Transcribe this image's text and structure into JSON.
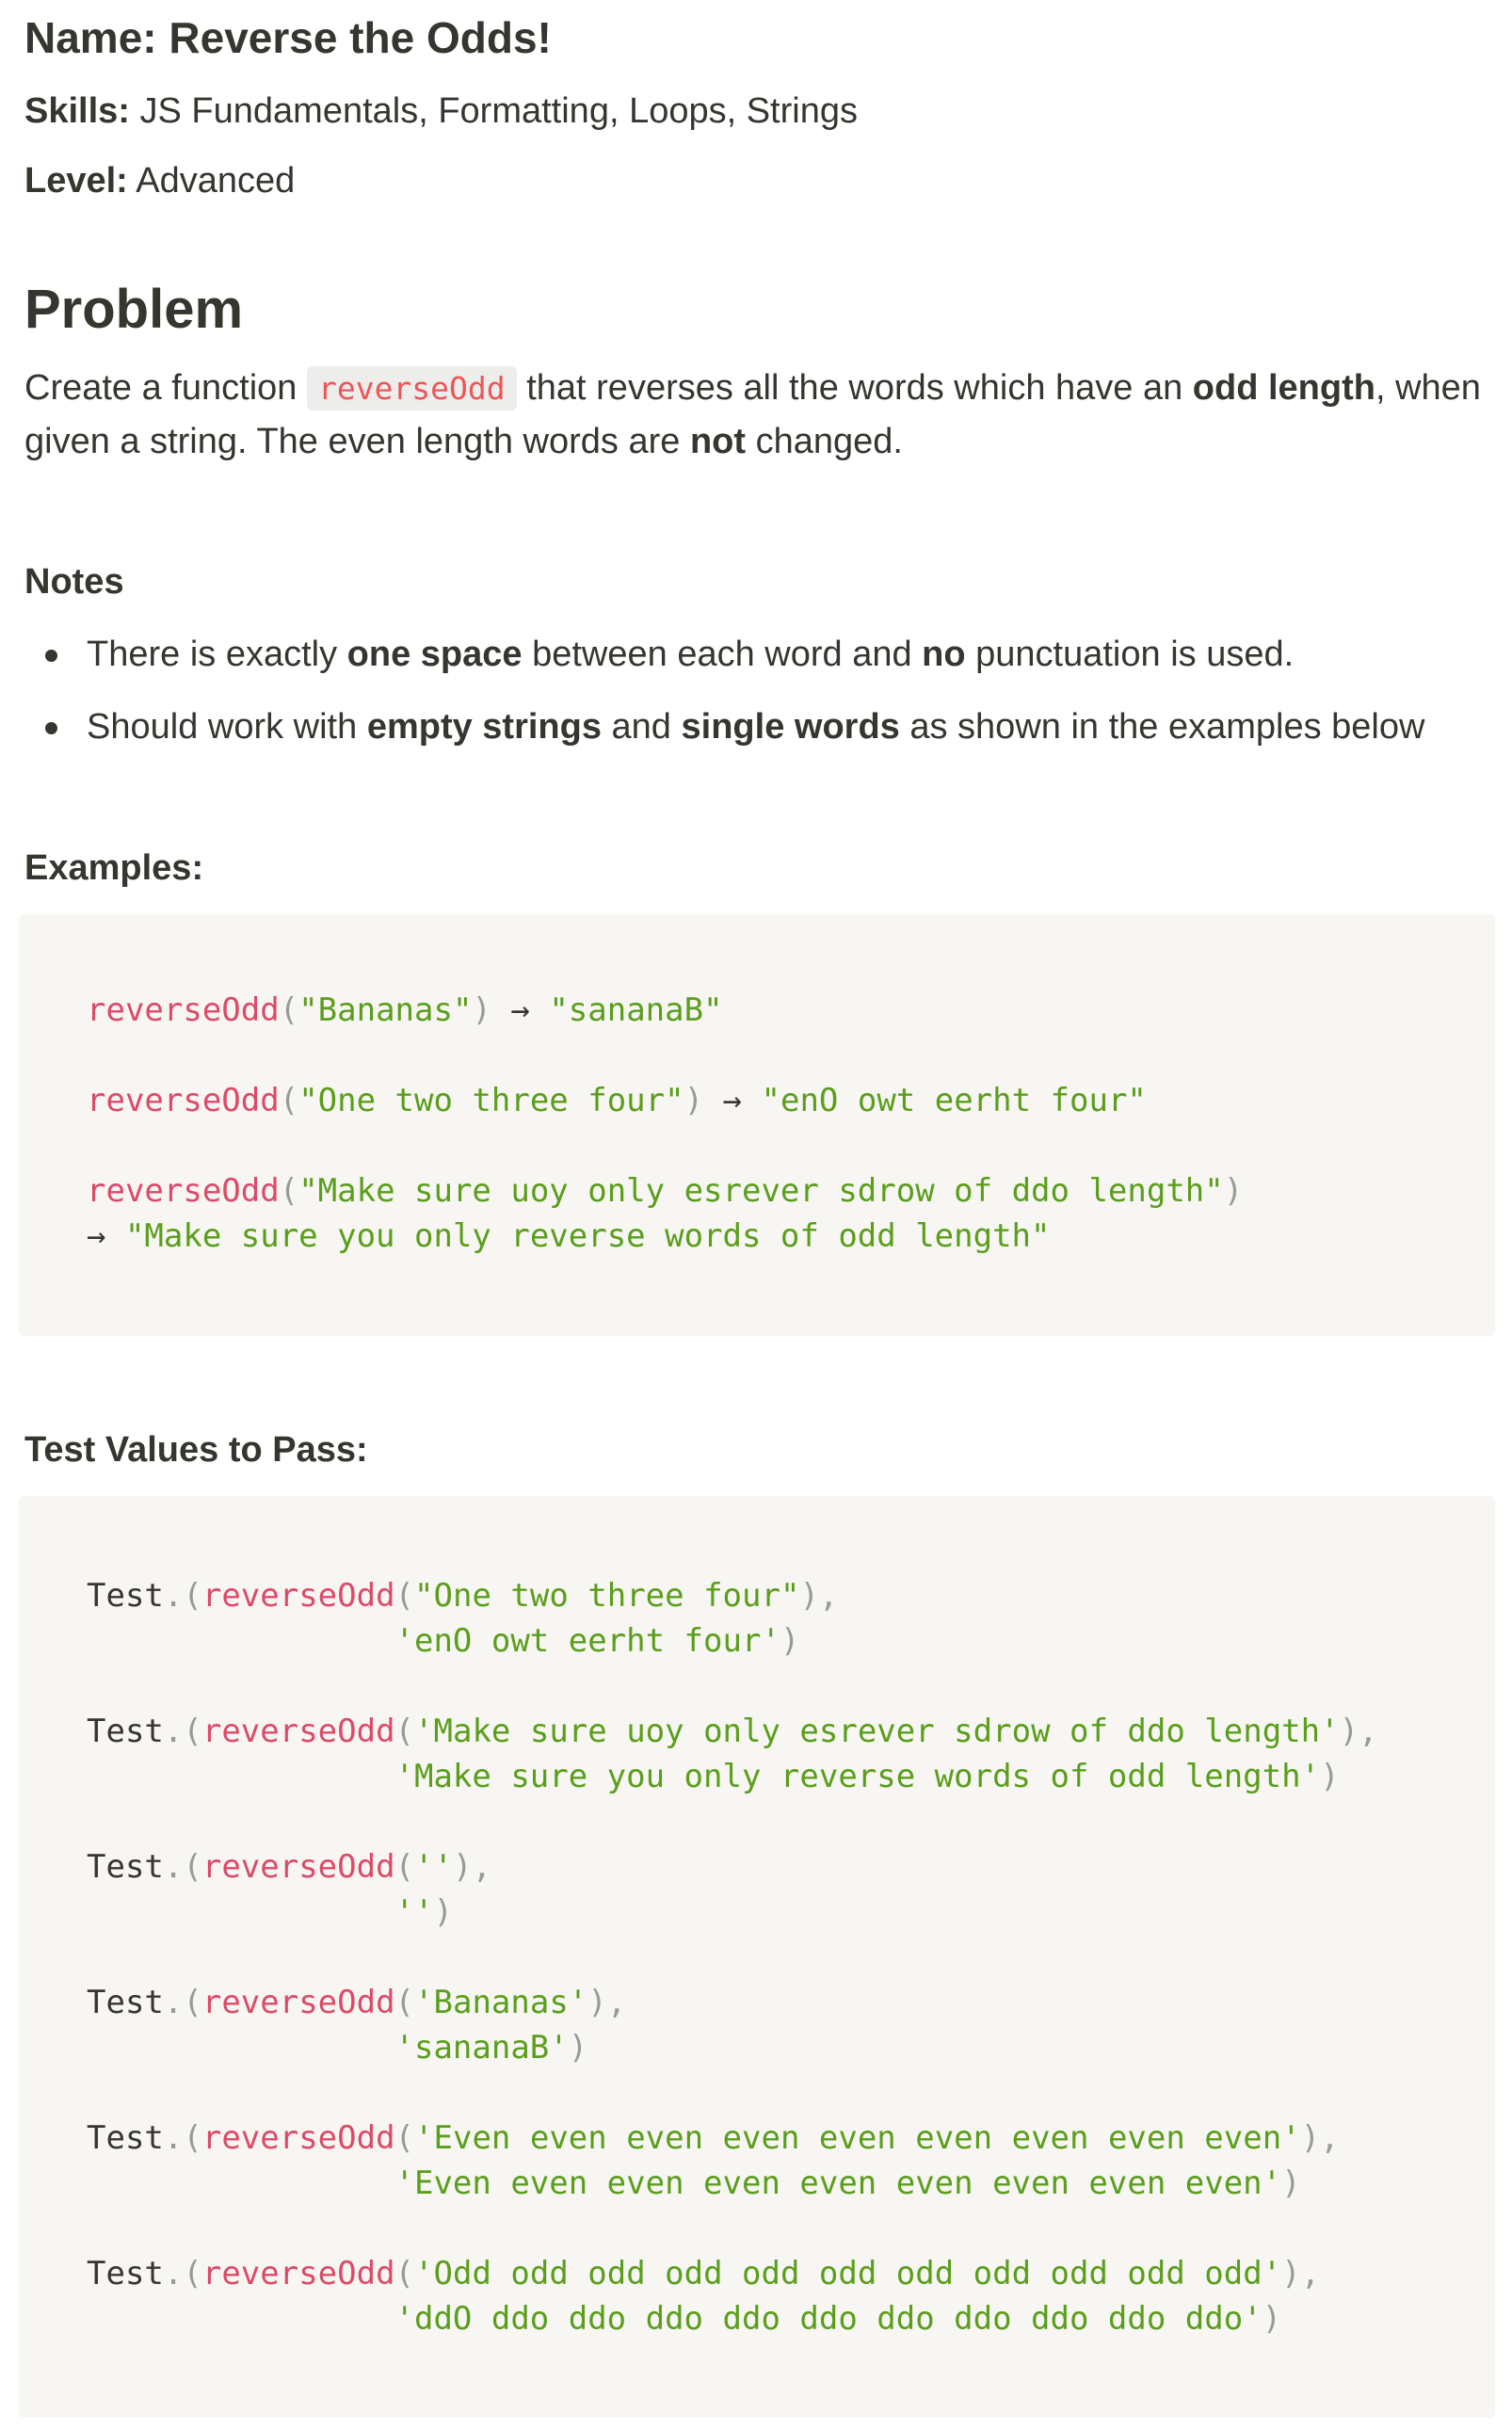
{
  "header": {
    "name_label": "Name:",
    "name_value": "Reverse the Odds!",
    "skills_label": "Skills:",
    "skills_value": "JS Fundamentals, Formatting, Loops, Strings",
    "level_label": "Level:",
    "level_value": "Advanced"
  },
  "problem": {
    "heading": "Problem",
    "text_1": "Create a function ",
    "code": "reverseOdd",
    "text_2": " that reverses all the words which have an ",
    "bold_1": "odd length",
    "text_3": ", when given a string. The even length words are ",
    "bold_2": "not",
    "text_4": " changed."
  },
  "notes": {
    "heading": "Notes",
    "bullet_1": {
      "t1": "There is exactly ",
      "b1": "one space",
      "t2": " between each word and ",
      "b2": "no",
      "t3": " punctuation is used."
    },
    "bullet_2": {
      "t1": "Should work with ",
      "b1": "empty strings",
      "t2": " and ",
      "b2": "single words",
      "t3": " as shown in the examples below"
    }
  },
  "examples": {
    "heading": "Examples:",
    "ex1": {
      "fn": "reverseOdd",
      "open": "(",
      "arg": "\"Bananas\"",
      "close": ")",
      "arrow": " → ",
      "result": "\"sananaB\""
    },
    "ex2": {
      "fn": "reverseOdd",
      "open": "(",
      "arg": "\"One two three four\"",
      "close": ")",
      "arrow": " → ",
      "result": "\"enO owt eerht four\""
    },
    "ex3": {
      "fn": "reverseOdd",
      "open": "(",
      "arg": "\"Make sure uoy only esrever sdrow of ddo length\"",
      "close": ")",
      "arrow": "→ ",
      "result": "\"Make sure you only reverse words of odd length\""
    }
  },
  "tests": {
    "heading": "Test Values to Pass:",
    "test_word": "Test",
    "dot_paren": ".(",
    "fn": "reverseOdd",
    "items": [
      {
        "arg": "\"One two three four\"",
        "expected": "'enO owt eerht four'"
      },
      {
        "arg": "'Make sure uoy only esrever sdrow of ddo length'",
        "expected": "'Make sure you only reverse words of odd length'"
      },
      {
        "arg": "''",
        "expected": "''"
      },
      {
        "arg": "'Bananas'",
        "expected": "'sananaB'"
      },
      {
        "arg": "'Even even even even even even even even even'",
        "expected": "'Even even even even even even even even even'"
      },
      {
        "arg": "'Odd odd odd odd odd odd odd odd odd odd odd'",
        "expected": "'ddO ddo ddo ddo ddo ddo ddo ddo ddo ddo ddo'"
      }
    ]
  },
  "colors": {
    "text": "#37352f",
    "code_function": "#dd4a68",
    "code_string": "#5a9e1b",
    "code_punctuation": "#999999",
    "inline_code": "#eb5757",
    "code_background": "#f7f6f3"
  }
}
